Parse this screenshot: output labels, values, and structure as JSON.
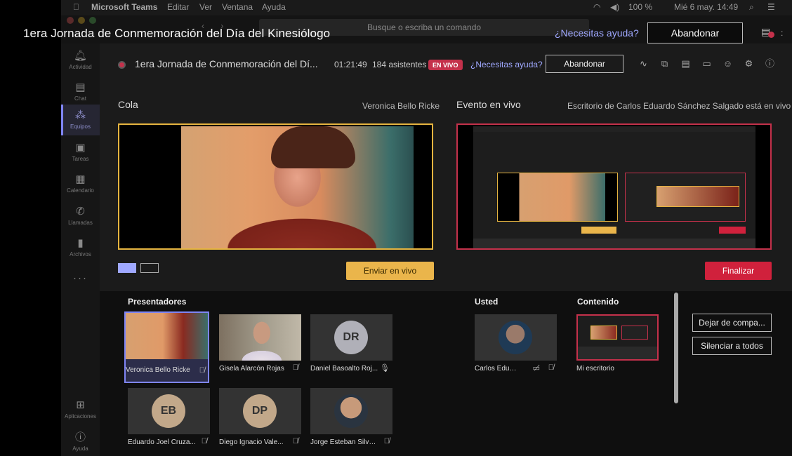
{
  "mac": {
    "app": "Microsoft Teams",
    "menus": [
      "Editar",
      "Ver",
      "Ventana",
      "Ayuda"
    ],
    "battery": "100 %",
    "clock": "Mié 6 may.  14:49"
  },
  "teams": {
    "search_placeholder": "Busque o escriba un comando"
  },
  "overlay": {
    "title": "1era Jornada de Conmemoración del Día del Kinesiólogo",
    "help": "¿Necesitas ayuda?",
    "leave": "Abandonar"
  },
  "rail": [
    {
      "label": "Actividad",
      "icon": "bell-icon"
    },
    {
      "label": "Chat",
      "icon": "chat-icon"
    },
    {
      "label": "Equipos",
      "icon": "teams-icon"
    },
    {
      "label": "Tareas",
      "icon": "tasks-icon"
    },
    {
      "label": "Calendario",
      "icon": "calendar-icon"
    },
    {
      "label": "Llamadas",
      "icon": "phone-icon"
    },
    {
      "label": "Archivos",
      "icon": "files-icon"
    },
    {
      "label": "Aplicaciones",
      "icon": "apps-icon"
    },
    {
      "label": "Ayuda",
      "icon": "help-icon"
    }
  ],
  "meeting": {
    "title": "1era Jornada de Conmemoración del Dí...",
    "time": "01:21:49",
    "attendees": "184 asistentes",
    "live": "EN VIVO",
    "help": "¿Necesitas ayuda?",
    "leave": "Abandonar"
  },
  "queue": {
    "title": "Cola",
    "presenter": "Veronica Bello Ricke",
    "send": "Enviar en vivo"
  },
  "live": {
    "title": "Evento en vivo",
    "status": "Escritorio de Carlos Eduardo Sánchez Salgado está en vivo",
    "end": "Finalizar"
  },
  "groups": {
    "presenters": "Presentadores",
    "you": "Usted",
    "content": "Contenido"
  },
  "presenters": [
    {
      "name": "Veronica Bello Ricke",
      "initials": ""
    },
    {
      "name": "Gisela Alarcón Rojas",
      "initials": ""
    },
    {
      "name": "Daniel Basoalto Roj...",
      "initials": "DR"
    },
    {
      "name": "Eduardo Joel Cruza...",
      "initials": "EB"
    },
    {
      "name": "Diego Ignacio Vale...",
      "initials": "DP"
    },
    {
      "name": "Jorge Esteban Silva...",
      "initials": ""
    }
  ],
  "you": {
    "name": "Carlos Eduar..."
  },
  "content": {
    "name": "Mi escritorio"
  },
  "actions": {
    "stop_share": "Dejar de compa...",
    "mute_all": "Silenciar a todos"
  }
}
